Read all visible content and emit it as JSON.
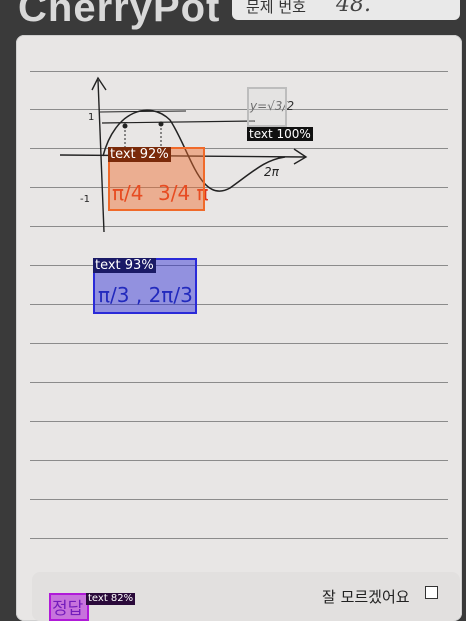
{
  "header": {
    "brand": "CherryPot",
    "question_label": "문제 번호",
    "question_number": "48."
  },
  "detections": [
    {
      "label": "text 100%",
      "color": "#bdbdbd",
      "tag_bg": "#111111"
    },
    {
      "label": "text 92%",
      "color": "#f06a2a",
      "tag_bg": "#7a2a0a"
    },
    {
      "label": "text 93%",
      "color": "#2a2ad8",
      "tag_bg": "#1a1a66"
    },
    {
      "label": "text 82%",
      "color": "#b01ad8",
      "tag_bg": "#2a0a3a"
    }
  ],
  "footer": {
    "answer_label": "정답",
    "dont_know_label": "잘 모르겠어요"
  },
  "handwriting": {
    "graph_eq": "y=√3/2",
    "answer_frac_1": "π/4",
    "answer_frac_2": "3/4 π",
    "answer_line_2": "π/3 , 2π/3",
    "axis_two_pi": "2π",
    "axis_one": "1",
    "axis_neg_one": "-1"
  }
}
